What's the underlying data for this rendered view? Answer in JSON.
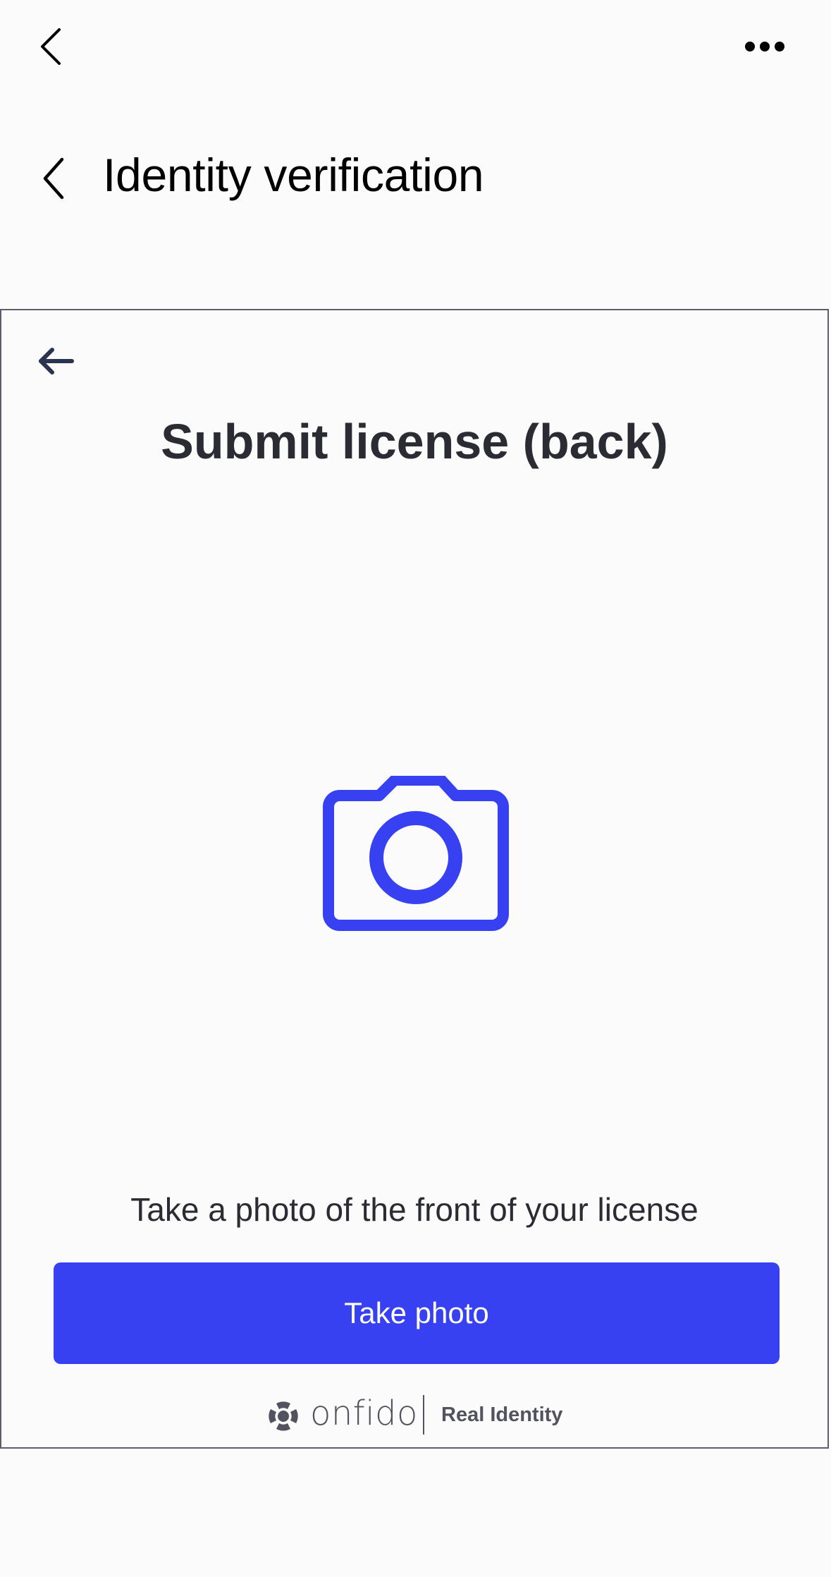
{
  "top_bar": {
    "back_icon": "chevron-left-icon",
    "more_icon": "more-horizontal-icon"
  },
  "header": {
    "back_icon": "chevron-left-icon",
    "title": "Identity verification"
  },
  "verification_frame": {
    "back_icon": "arrow-left-icon",
    "title": "Submit license (back)",
    "camera_icon": "camera-icon",
    "instruction": "Take a photo of the front of your license",
    "primary_button_label": "Take photo",
    "brand": {
      "logo": "onfido-logo",
      "name": "onfido",
      "tagline": "Real Identity"
    }
  },
  "colors": {
    "accent": "#3841f2",
    "text": "#2a2b33",
    "frame_border": "#5c5e6b",
    "background": "#fbfbfb"
  }
}
